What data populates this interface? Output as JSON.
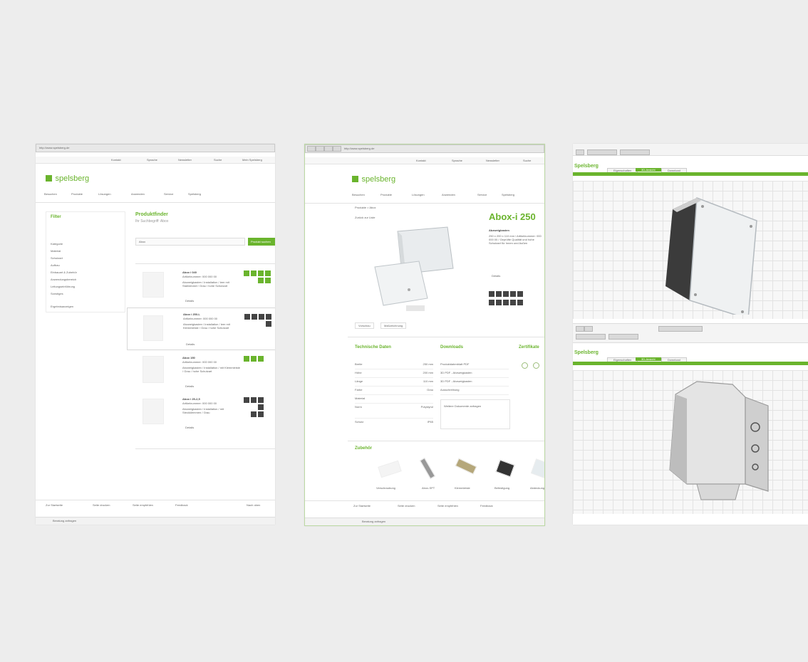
{
  "panel1": {
    "url": "http://www.spelsberg.de",
    "top_links": [
      "Kontakt",
      "Sprache",
      "Newsletter",
      "Suche",
      "Mein Spelsberg"
    ],
    "logo_text": "spelsberg",
    "nav": [
      "Besuchen",
      "Produkte",
      "Lösungen",
      "Anwenden",
      "Service",
      "Spelsberg"
    ],
    "filter_title": "Filter",
    "filter_items": [
      "Kategorie",
      "Material",
      "Schutzart",
      "Aufbau",
      "Einbauart & Zubehör",
      "Anwendungsbereich",
      "Leitungseinführung",
      "Sonstiges",
      "Ergebnisanzeigen"
    ],
    "heading": "Produktfinder",
    "subheading": "Ihr Suchbegriff: Abox",
    "search_value": "Abox",
    "search_button": "Produkt suchen",
    "products": [
      {
        "name": "Abox i 040",
        "code": "Artikelnummer: 000 000 00",
        "desc": "Abzweigkasten / Installation / leer mit Stahldeckel / Grau / hohe Schutzart",
        "link": "Details"
      },
      {
        "name": "Abox i 250-L",
        "code": "Artikelnummer: 000 000 00",
        "desc": "Abzweigkasten / Installation / leer mit Klemmleiste / Grau / hohe Schutzart",
        "link": "Details"
      },
      {
        "name": "Abox 150",
        "code": "Artikelnummer: 000 000 00",
        "desc": "Abzweigkasten / Installation / mit Klemmleiste / Grau / hohe Schutzart",
        "link": "Details"
      },
      {
        "name": "Abox i 25-2,5",
        "code": "Artikelnummer: 000 000 00",
        "desc": "Abzweigkasten / Installation / mit Steckklemmen / Grau",
        "link": "Details"
      }
    ],
    "footer_links": [
      "Zur Startseite",
      "Seite drucken",
      "Seite empfehlen",
      "Feedback",
      "Nach oben"
    ],
    "status": "Beratung anfragen"
  },
  "panel2": {
    "url": "http://www.spelsberg.de",
    "top_links": [
      "Kontakt",
      "Sprache",
      "Newsletter",
      "Suche"
    ],
    "logo_text": "spelsberg",
    "nav": [
      "Besuchen",
      "Produkte",
      "Lösungen",
      "Anwenden",
      "Service",
      "Spelsberg"
    ],
    "breadcrumb": "Produkte > Abox",
    "back_link": "Zurück zur Liste",
    "product_title": "Abox-i 250",
    "product_sub": "Abzweigkasten",
    "product_desc": "250 x 200 x 110 mm / Artikelnummer: 000 000 00 / Geprüfte Qualität und hohe Schutzart für Innen und Außen",
    "product_link": "Details",
    "gallery_tabs": [
      "Vorschau",
      "Maßzeichnung"
    ],
    "sections": [
      "Technische Daten",
      "Downloads",
      "Zertifikate"
    ],
    "tech_rows": [
      [
        "Breite",
        "250 mm"
      ],
      [
        "Höhe",
        "200 mm"
      ],
      [
        "Länge",
        "110 mm"
      ],
      [
        "Farbe",
        "Grau"
      ],
      [
        "Material",
        ""
      ],
      [
        "Norm",
        "Polystyrol"
      ],
      [
        "Schutz",
        "IP65"
      ]
    ],
    "downloads": [
      "Produktdatenblatt PDF",
      "3D PDF - Abzweigkasten",
      "3D PDF - Abzweigkasten",
      "Ausschreibung"
    ],
    "notice": "Weitere Dokumente anfragen",
    "accessories_title": "Zubehör",
    "accessories": [
      "Verschraubung",
      "Abox-SPT",
      "Klemmleiste",
      "Befestigung",
      "Abdeckung"
    ],
    "footer_links": [
      "Zur Startseite",
      "Seite drucken",
      "Seite empfehlen",
      "Feedback"
    ],
    "status": "Beratung anfragen"
  },
  "panel3": {
    "brand_top": "Spelsberg",
    "brand_bottom": "Spelsberg",
    "tabs_top": [
      "Eigenschaften",
      "3D-Ansicht",
      "Download"
    ],
    "tabs_bottom": [
      "Eigenschaften",
      "3D-Ansicht",
      "Download"
    ]
  },
  "colors": {
    "accent": "#6ab42d",
    "background": "#ededed",
    "dark_square": "#444444"
  }
}
